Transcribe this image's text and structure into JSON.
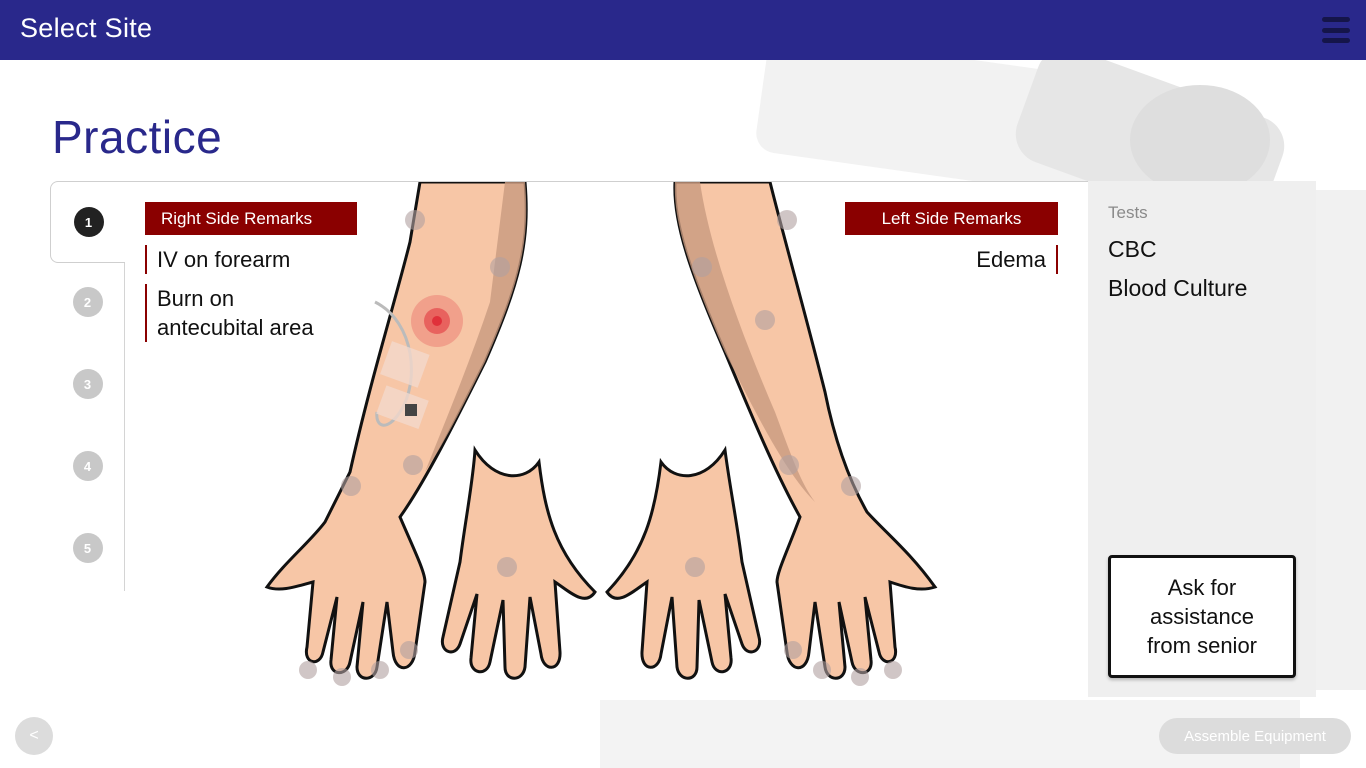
{
  "header": {
    "title": "Select Site",
    "menu_icon": "hamburger-menu-icon"
  },
  "page": {
    "title": "Practice"
  },
  "steps": [
    {
      "label": "1",
      "active": true
    },
    {
      "label": "2",
      "active": false
    },
    {
      "label": "3",
      "active": false
    },
    {
      "label": "4",
      "active": false
    },
    {
      "label": "5",
      "active": false
    }
  ],
  "remarks": {
    "right_header": "Right Side Remarks",
    "right_items": [
      "IV on forearm",
      "Burn on",
      "antecubital area"
    ],
    "left_header": "Left Side Remarks",
    "left_items": [
      "Edema"
    ]
  },
  "tests": {
    "label": "Tests",
    "items": [
      "CBC",
      "Blood Culture"
    ]
  },
  "assist_button": {
    "line1": "Ask for",
    "line2": "assistance",
    "line3": "from senior"
  },
  "footer": {
    "back_label": "<",
    "next_label": "Assemble Equipment"
  },
  "colors": {
    "header_bg": "#29288b",
    "title": "#29288b",
    "remark_header_bg": "#8a0000",
    "skin": "#f7c6a6",
    "skin_shadow": "#c89a80",
    "site_marker": "#b0a0a0",
    "burn": "#e0303a"
  }
}
